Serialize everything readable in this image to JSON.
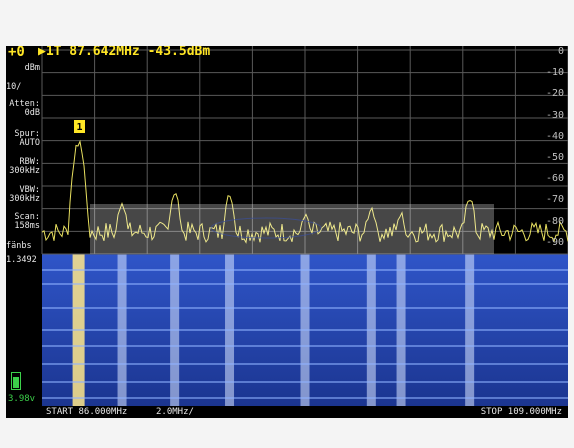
{
  "header": {
    "ref_level": "+0",
    "marker_line": "▶1T  87.642MHz -43.5dBm"
  },
  "side_panel": {
    "unit": "dBm",
    "scale": "10/",
    "atten": "Atten:\n 0dB",
    "spur": "Spur:\nAUTO",
    "rbw": "RBW:\n300kHz",
    "vbw": "VBW:\n300kHz",
    "scan": "Scan:\n 158ms",
    "fps_label": "fänbs",
    "fps_value": "1.3492",
    "battery": "3.98v"
  },
  "right_axis": [
    "0",
    "-10",
    "-20",
    "-30",
    "-40",
    "-50",
    "-60",
    "-70",
    "-80",
    "-90"
  ],
  "marker": {
    "id": "1"
  },
  "footer": {
    "start": "START 86.000MHz",
    "span": "2.0MHz/",
    "stop": "STOP 109.000MHz"
  },
  "colors": {
    "trace": "#e8e060",
    "marker": "#ffe626",
    "waterfall_base": "#1f3d9e"
  },
  "chart_data": {
    "type": "line",
    "x_label": "",
    "x_start_mhz": 86.0,
    "x_stop_mhz": 109.0,
    "y_range_dbm": [
      -90,
      0
    ],
    "peaks": [
      {
        "freq_mhz": 87.6,
        "level_dbm": -42
      },
      {
        "freq_mhz": 89.5,
        "level_dbm": -68
      },
      {
        "freq_mhz": 91.8,
        "level_dbm": -64
      },
      {
        "freq_mhz": 94.2,
        "level_dbm": -65
      },
      {
        "freq_mhz": 97.5,
        "level_dbm": -73
      },
      {
        "freq_mhz": 100.4,
        "level_dbm": -70
      },
      {
        "freq_mhz": 101.7,
        "level_dbm": -73
      },
      {
        "freq_mhz": 104.7,
        "level_dbm": -66
      }
    ]
  }
}
